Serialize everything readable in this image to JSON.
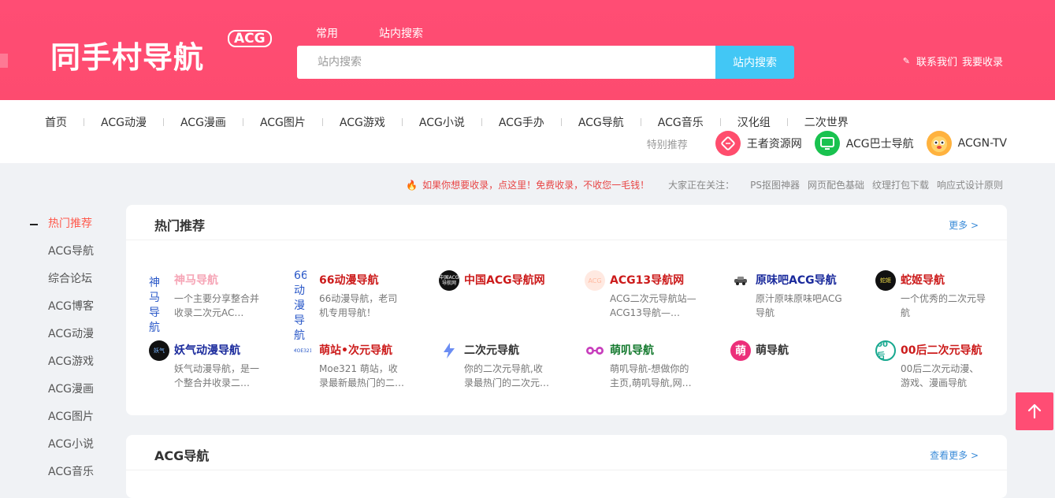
{
  "header": {
    "logo": "同手村导航",
    "logo_badge": "ACG",
    "search_tabs": [
      "常用",
      "站内搜索"
    ],
    "search_placeholder": "站内搜索",
    "search_button": "站内搜索",
    "links": [
      "联系我们",
      "我要收录"
    ]
  },
  "nav": {
    "items": [
      "首页",
      "ACG动漫",
      "ACG漫画",
      "ACG图片",
      "ACG游戏",
      "ACG小说",
      "ACG手办",
      "ACG导航",
      "ACG音乐",
      "汉化组",
      "二次世界"
    ],
    "featured_label": "特别推荐",
    "featured": [
      {
        "label": "王者资源网",
        "icon": "pink-ticket-icon",
        "color": "#ff4d6d"
      },
      {
        "label": "ACG巴士导航",
        "icon": "green-tv-icon",
        "color": "#19c24f"
      },
      {
        "label": "ACGN-TV",
        "icon": "mascot-face-icon",
        "color": "#ff9d2e"
      }
    ]
  },
  "notice": {
    "message": "如果你想要收录，点这里！免费收录，不收您一毛钱！",
    "label": "大家正在关注：",
    "links": [
      "PS抠图神器",
      "网页配色基础",
      "纹理打包下载",
      "响应式设计原则"
    ]
  },
  "sidebar": {
    "items": [
      "热门推荐",
      "ACG导航",
      "综合论坛",
      "ACG博客",
      "ACG动漫",
      "ACG游戏",
      "ACG漫画",
      "ACG图片",
      "ACG小说",
      "ACG音乐"
    ]
  },
  "hot": {
    "title": "热门推荐",
    "more": "更多 >",
    "sites": [
      {
        "name": "神马导航",
        "desc": "一个主要分享整合并收录二次元AC…",
        "name_color": "#f6a5b6",
        "icon_alt": "神马导航",
        "icon": "broken-image-icon"
      },
      {
        "name": "66动漫导航",
        "desc": "66动漫导航，老司机专用导航！",
        "name_color": "#cc1b1b",
        "icon_alt": "66动漫导航",
        "icon": "broken-image-icon"
      },
      {
        "name": "中国ACG导航网",
        "desc": "",
        "name_color": "#cc1b1b",
        "icon": "china-acg-logo-icon",
        "icon_color": "#111111",
        "icon_text": "中国ACG导航网"
      },
      {
        "name": "ACG13导航网",
        "desc": "ACG二次元导航站—ACG13导航—…",
        "name_color": "#cc1b1b",
        "icon": "acg13-logo-icon",
        "icon_color": "#ffe3d9",
        "icon_text": "ACG"
      },
      {
        "name": "原味吧ACG导航",
        "desc": "原汁原味原味吧ACG导航",
        "name_color": "#1a2a9c",
        "icon": "car-logo-icon",
        "icon_color": "#ffffff",
        "icon_text": "🚗"
      },
      {
        "name": "蛇姬导航",
        "desc": "一个优秀的二次元导航",
        "name_color": "#cc1b1b",
        "icon": "snake-logo-icon",
        "icon_color": "#111111",
        "icon_text": "蛇姬"
      },
      {
        "name": "妖气动漫导航",
        "desc": "妖气动漫导航，是一个整合并收录二…",
        "name_color": "#1a2a9c",
        "icon": "yaoqi-logo-icon",
        "icon_color": "#111111",
        "icon_text": "妖气"
      },
      {
        "name": "萌站•次元导航",
        "desc": "Moe321 萌站，收录最新最热门的二…",
        "name_color": "#cc1b1b",
        "icon_alt": "MOE321",
        "icon": "moe321-logo-icon"
      },
      {
        "name": "二次元导航",
        "desc": "你的二次元导航,收录最热门的二次元…",
        "name_color": "#333333",
        "icon": "lightning-icon",
        "icon_color": "#e8efff",
        "icon_text": "⚡"
      },
      {
        "name": "萌叽导航",
        "desc": "萌叽导航-想做你的主页,萌叽导航,网…",
        "name_color": "#157a2f",
        "icon": "glasses-logo-icon",
        "icon_color": "#ffffff",
        "icon_text": "👓"
      },
      {
        "name": "萌导航",
        "desc": "",
        "name_color": "#333333",
        "icon": "meng-logo-icon",
        "icon_color": "#ec2f7a",
        "icon_text": "萌"
      },
      {
        "name": "00后二次元导航",
        "desc": "00后二次元动漫、游戏、漫画导航",
        "name_color": "#cc1b1b",
        "icon": "00-logo-icon",
        "icon_color": "#ffffff",
        "icon_text": "00后"
      }
    ]
  },
  "acg_nav": {
    "title": "ACG导航",
    "more": "查看更多 >"
  },
  "colors": {
    "brand": "#ff4d74",
    "search_button": "#42c7f5",
    "active": "#ff5a4d"
  }
}
